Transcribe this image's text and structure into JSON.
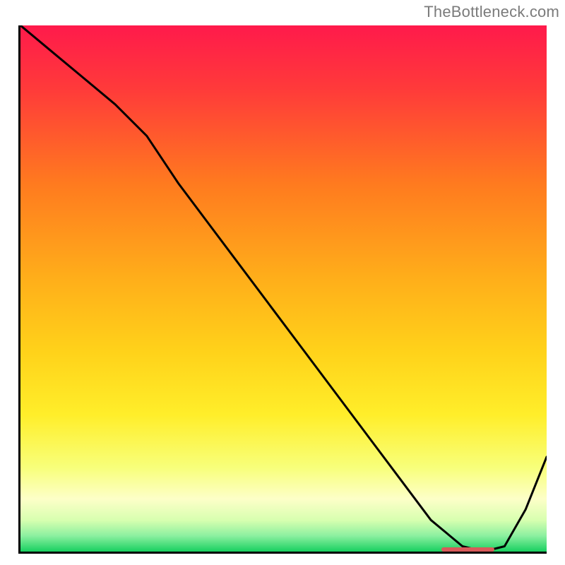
{
  "watermark": "TheBottleneck.com",
  "chart_data": {
    "type": "line",
    "title": "",
    "xlabel": "",
    "ylabel": "",
    "xlim": [
      0,
      100
    ],
    "ylim": [
      0,
      100
    ],
    "series": [
      {
        "name": "bottleneck-curve",
        "x": [
          0,
          6,
          12,
          18,
          24,
          30,
          36,
          42,
          48,
          54,
          60,
          66,
          72,
          78,
          84,
          88,
          92,
          96,
          100
        ],
        "y": [
          100,
          95,
          90,
          85,
          79,
          70,
          62,
          54,
          46,
          38,
          30,
          22,
          14,
          6,
          1,
          0,
          1,
          8,
          18
        ]
      }
    ],
    "marker": {
      "name": "optimal-range",
      "x_start": 80,
      "x_end": 90,
      "y": 0
    },
    "gradient_stops": [
      {
        "offset": 0.0,
        "color": "#ff1a4b"
      },
      {
        "offset": 0.12,
        "color": "#ff3a3a"
      },
      {
        "offset": 0.3,
        "color": "#ff7a1f"
      },
      {
        "offset": 0.48,
        "color": "#ffae1a"
      },
      {
        "offset": 0.62,
        "color": "#ffd21a"
      },
      {
        "offset": 0.74,
        "color": "#ffee2a"
      },
      {
        "offset": 0.84,
        "color": "#f8ff7a"
      },
      {
        "offset": 0.9,
        "color": "#fdffc8"
      },
      {
        "offset": 0.94,
        "color": "#d8ffb0"
      },
      {
        "offset": 0.97,
        "color": "#8cf0a0"
      },
      {
        "offset": 1.0,
        "color": "#18d060"
      }
    ]
  }
}
